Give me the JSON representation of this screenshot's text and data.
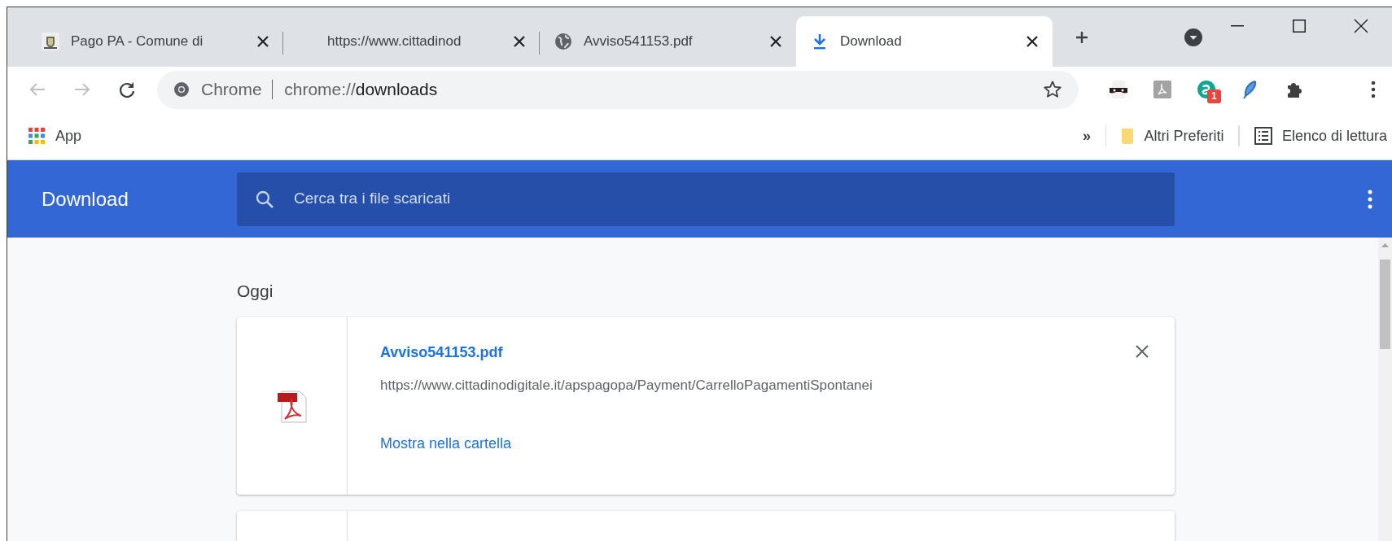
{
  "tabs": [
    {
      "kind": "crest",
      "title": "Pago PA - Comune di",
      "selected": false
    },
    {
      "kind": "none",
      "title": "https://www.cittadinod",
      "selected": false
    },
    {
      "kind": "globe",
      "title": "Avviso541153.pdf",
      "selected": false
    },
    {
      "kind": "download",
      "title": "Download",
      "selected": true
    }
  ],
  "omnibox": {
    "site": "Chrome",
    "url_prefix": "chrome://",
    "url_path": "downloads"
  },
  "extensions": [
    {
      "kind": "mask"
    },
    {
      "kind": "pdf"
    },
    {
      "kind": "letter",
      "badge": "1"
    },
    {
      "kind": "feather"
    },
    {
      "kind": "puzzle"
    }
  ],
  "bookmarks_bar": {
    "apps": "App",
    "overflow": "»",
    "items": [
      {
        "kind": "folder",
        "label": "Altri Preferiti"
      },
      {
        "kind": "list",
        "label": "Elenco di lettura"
      }
    ]
  },
  "page": {
    "title": "Download",
    "search": {
      "placeholder": "Cerca tra i file scaricati"
    },
    "section": "Oggi",
    "downloads": [
      {
        "file": "Avviso541153.pdf",
        "source": "https://www.cittadinodigitale.it/apspagopa/Payment/CarrelloPagamentiSpontanei",
        "action": "Mostra nella cartella"
      }
    ]
  }
}
